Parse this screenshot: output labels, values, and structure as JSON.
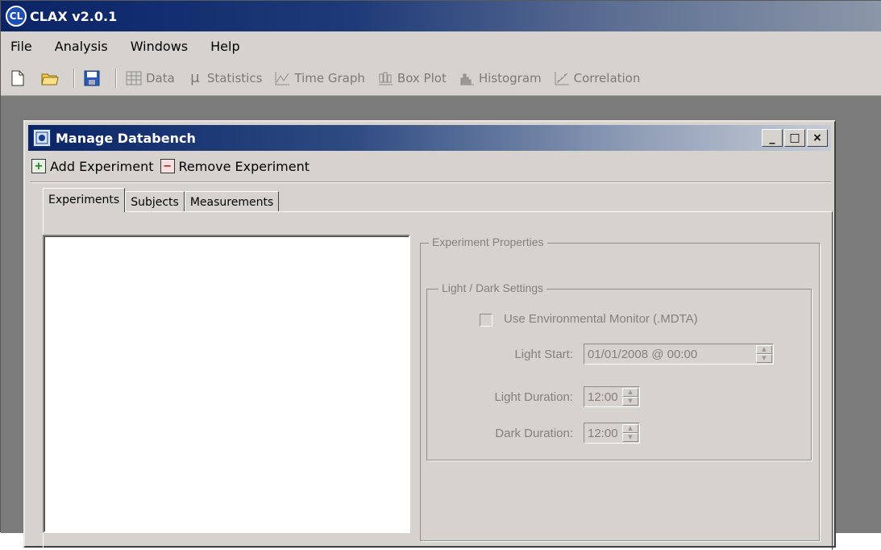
{
  "app": {
    "title": "CLAX v2.0.1",
    "icon": "clax-logo-icon",
    "icon_text": "CL"
  },
  "menu": [
    {
      "label": "File"
    },
    {
      "label": "Analysis"
    },
    {
      "label": "Windows"
    },
    {
      "label": "Help"
    }
  ],
  "toolbar": {
    "data": "Data",
    "statistics": "Statistics",
    "time_graph": "Time Graph",
    "box_plot": "Box Plot",
    "histogram": "Histogram",
    "correlation": "Correlation",
    "stats_glyph": "μ"
  },
  "window": {
    "title": "Manage Databench",
    "minimize": "_",
    "maximize": "□",
    "close": "×"
  },
  "actions": {
    "add": "Add Experiment",
    "remove": "Remove Experiment",
    "add_glyph": "+",
    "remove_glyph": "−"
  },
  "tabs": [
    {
      "label": "Experiments",
      "active": true
    },
    {
      "label": "Subjects",
      "active": false
    },
    {
      "label": "Measurements",
      "active": false
    }
  ],
  "properties": {
    "group_title": "Experiment Properties",
    "light_dark": {
      "group_title": "Light / Dark Settings",
      "use_env_monitor": {
        "label": "Use Environmental Monitor (.MDTA)",
        "checked": false,
        "enabled": false
      },
      "light_start": {
        "label": "Light Start:",
        "value": "01/01/2008 @ 00:00"
      },
      "light_duration": {
        "label": "Light Duration:",
        "value": "12:00"
      },
      "dark_duration": {
        "label": "Dark Duration:",
        "value": "12:00"
      }
    }
  },
  "colors": {
    "titlebar_start": "#0a2466",
    "face": "#d6d3ce",
    "workspace": "#7b7b7b",
    "disabled_text": "#84817c"
  }
}
